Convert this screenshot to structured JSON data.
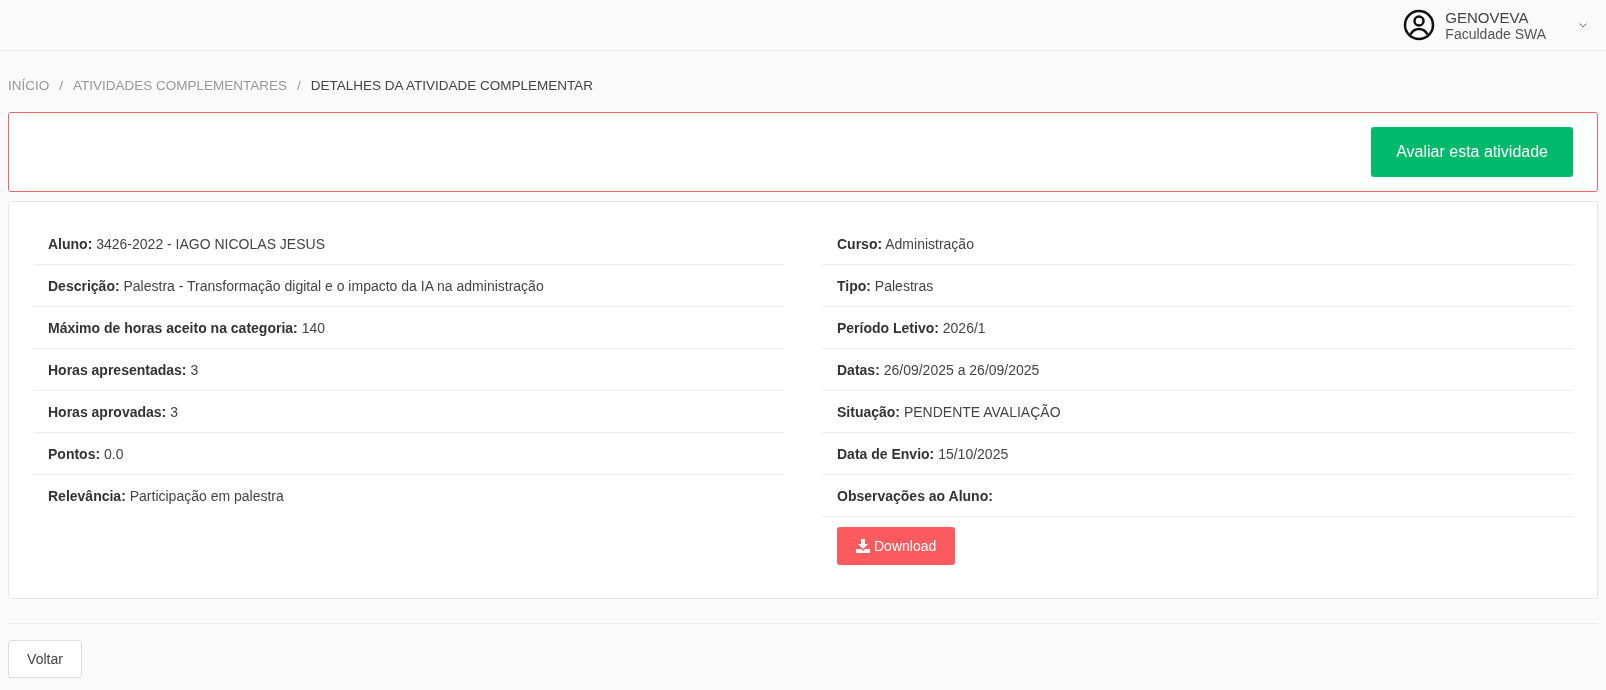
{
  "user": {
    "name": "GENOVEVA",
    "institution": "Faculdade SWA"
  },
  "breadcrumb": [
    {
      "label": "INÍCIO",
      "selected": false
    },
    {
      "separator": "/",
      "label": "ATIVIDADES COMPLEMENTARES",
      "selected": false
    },
    {
      "separator": "/",
      "label": "DETALHES DA ATIVIDADE COMPLEMENTAR",
      "selected": true
    }
  ],
  "evaluate_button": "Avaliar esta atividade",
  "left_fields": [
    {
      "label": "Aluno:",
      "value": "3426-2022 - IAGO NICOLAS JESUS"
    },
    {
      "label": "Descrição:",
      "value": "Palestra - Transformação digital e o impacto da IA na administração"
    },
    {
      "label": "Máximo de horas aceito na categoria:",
      "value": "140"
    },
    {
      "label": "Horas apresentadas:",
      "value": "3"
    },
    {
      "label": "Horas aprovadas:",
      "value": "3"
    },
    {
      "label": "Pontos:",
      "value": "0.0"
    },
    {
      "label": "Relevância:",
      "value": "Participação em palestra"
    }
  ],
  "right_fields": [
    {
      "label": "Curso:",
      "value": "Administração"
    },
    {
      "label": "Tipo:",
      "value": "Palestras"
    },
    {
      "label": "Período Letivo:",
      "value": "2026/1"
    },
    {
      "label": "Datas:",
      "value": "26/09/2025 a 26/09/2025"
    },
    {
      "label": "Situação:",
      "value": "PENDENTE AVALIAÇÃO"
    },
    {
      "label": "Data de Envio:",
      "value": "15/10/2025"
    },
    {
      "label": "Observações ao Aluno:"
    }
  ],
  "download_button": "Download",
  "back_button": "Voltar"
}
